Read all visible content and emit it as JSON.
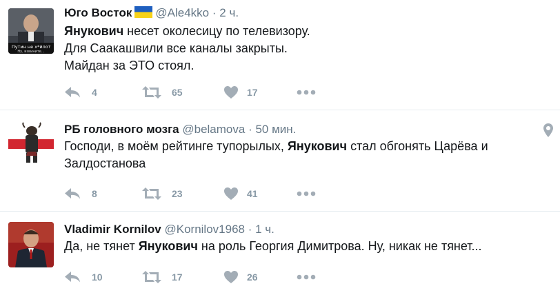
{
  "tweets": [
    {
      "fullname": "Юго Восток",
      "handle": "@Ale4kko",
      "sep": "·",
      "time": "2 ч.",
      "avatar_caption_1": "Путин не х*йло?",
      "avatar_caption_2": "Ну, извините...",
      "text_lines": [
        {
          "bold": "Янукович",
          "rest": " несет околесицу по телевизору."
        },
        {
          "bold": "",
          "rest": "Для Саакашвили все каналы закрыты."
        },
        {
          "bold": "",
          "rest": "Майдан за ЭТО стоял."
        }
      ],
      "reply_count": "4",
      "retweet_count": "65",
      "like_count": "17"
    },
    {
      "fullname": "РБ головного мозга",
      "handle": "@belamova",
      "sep": "·",
      "time": "50 мин.",
      "text_pre": "Господи, в моём рейтинге тупорылых, ",
      "text_bold": "Янукович",
      "text_post": " стал обгонять Царёва и",
      "text_line2": "Залдостанова",
      "reply_count": "8",
      "retweet_count": "23",
      "like_count": "41"
    },
    {
      "fullname": "Vladimir Kornilov",
      "handle": "@Kornilov1968",
      "sep": "·",
      "time": "1 ч.",
      "text_pre": "Да, не тянет ",
      "text_bold": "Янукович",
      "text_post": " на роль Георгия Димитрова. Ну, никак не тянет...",
      "reply_count": "10",
      "retweet_count": "17",
      "like_count": "26"
    }
  ],
  "icons": {
    "reply": "reply-icon",
    "retweet": "retweet-icon",
    "like": "heart-icon",
    "more": "more-dots-icon",
    "location": "location-pin-icon",
    "flag": "ukraine-flag-icon"
  },
  "colors": {
    "icon_gray": "#a3adb6",
    "text_secondary": "#657786",
    "divider": "#e6ecf0",
    "flag_blue": "#1f5fbf",
    "flag_yellow": "#f7d218",
    "belarus_red": "#d22630"
  }
}
